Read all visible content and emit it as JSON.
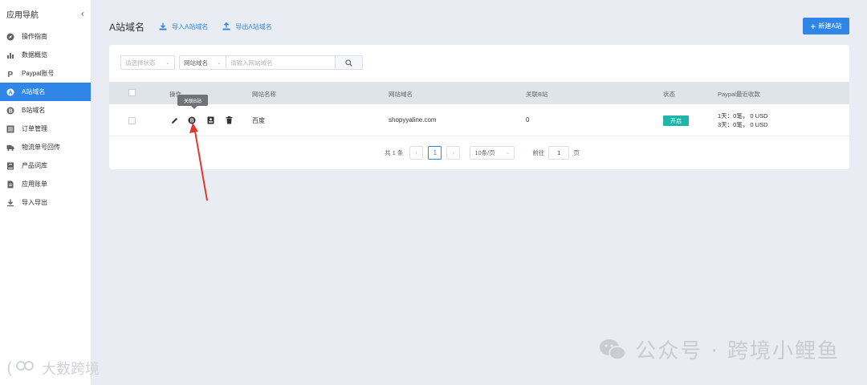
{
  "sidebar": {
    "title": "应用导航",
    "items": [
      {
        "label": "操作指南",
        "icon": "compass-icon"
      },
      {
        "label": "数据概览",
        "icon": "bar-chart-icon"
      },
      {
        "label": "Paypal账号",
        "icon": "paypal-icon"
      },
      {
        "label": "A站域名",
        "icon": "a-circle-icon"
      },
      {
        "label": "B站域名",
        "icon": "b-circle-icon"
      },
      {
        "label": "订单管理",
        "icon": "list-icon"
      },
      {
        "label": "物流单号回传",
        "icon": "truck-icon"
      },
      {
        "label": "产品词库",
        "icon": "book-icon"
      },
      {
        "label": "应用账单",
        "icon": "document-icon"
      },
      {
        "label": "导入导出",
        "icon": "download-icon"
      }
    ],
    "active_index": 3
  },
  "header": {
    "title": "A站域名",
    "import_label": "导入A站域名",
    "export_label": "导出A站域名",
    "new_label": "新建A站"
  },
  "filters": {
    "status_placeholder": "请选择状态",
    "field_select": "网站域名",
    "search_placeholder": "请输入网站域名"
  },
  "table": {
    "columns": [
      "操作",
      "网站名称",
      "网站域名",
      "关联B站",
      "状态",
      "Paypal最近收款"
    ],
    "rows": [
      {
        "name": "百度",
        "domain": "shopyyaline.com",
        "linked_b": "0",
        "status": "开启",
        "paypal_line1": "1天：0笔，  0 USD",
        "paypal_line2": "3天：0笔，  0 USD"
      }
    ]
  },
  "tooltip": "关联B站",
  "pagination": {
    "total": "共 1 条",
    "prev": "‹",
    "current": "1",
    "next": "›",
    "page_size": "10条/页",
    "goto_label": "前往",
    "goto_value": "1",
    "page_suffix": "页"
  },
  "watermarks": {
    "left": "大数跨境",
    "right": "公众号 · 跨境小鲤鱼"
  },
  "colors": {
    "accent": "#2f86e6",
    "status_on": "#1fb5a8",
    "annotation_arrow": "#e0392b"
  }
}
